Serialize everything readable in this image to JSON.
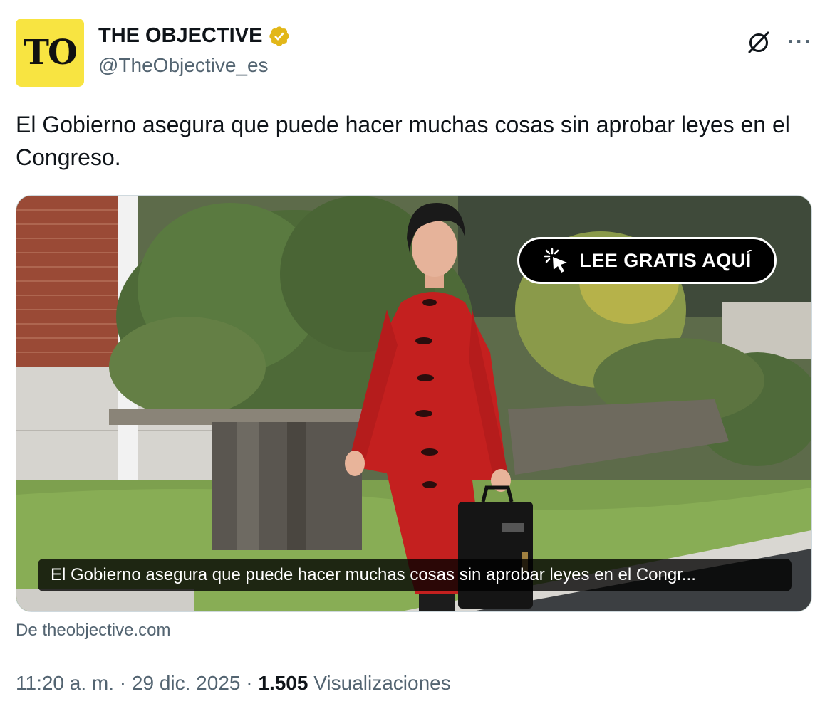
{
  "account": {
    "avatar_text": "TO",
    "display_name": "THE OBJECTIVE",
    "handle": "@TheObjective_es",
    "avatar_color": "#f8e441",
    "verified_badge": "verified-gold-badge-icon",
    "verified_color": "#e2b719"
  },
  "header_icons": {
    "grok": "grok-icon",
    "more": "more-icon",
    "more_glyph": "···"
  },
  "tweet": {
    "text": "El Gobierno asegura que puede hacer muchas cosas sin aprobar leyes en el Congreso."
  },
  "card": {
    "cta_label": "LEE GRATIS AQUÍ",
    "cta_icon": "cursor-click-icon",
    "caption": "El Gobierno asegura que puede hacer muchas cosas sin aprobar leyes en el Congr...",
    "source": "De theobjective.com"
  },
  "meta": {
    "time": "11:20 a. m.",
    "sep1": " · ",
    "date": "29 dic. 2025",
    "sep2": " · ",
    "views_count": "1.505",
    "views_label": " Visualizaciones"
  }
}
